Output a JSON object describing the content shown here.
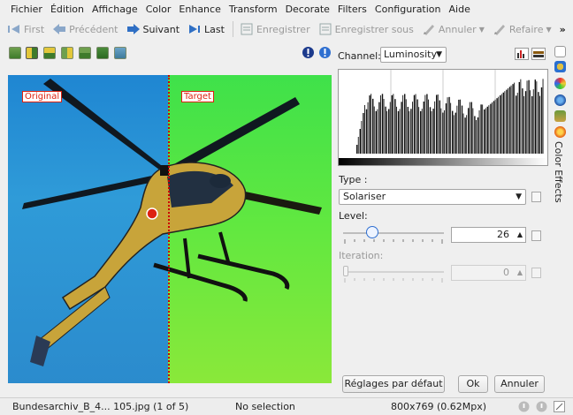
{
  "menubar": {
    "items": [
      "Fichier",
      "Édition",
      "Affichage",
      "Color",
      "Enhance",
      "Transform",
      "Decorate",
      "Filters",
      "Configuration",
      "Aide"
    ]
  },
  "toolbar": {
    "first": "First",
    "previous": "Précédent",
    "next": "Suivant",
    "last": "Last",
    "save": "Enregistrer",
    "save_as": "Enregistrer sous",
    "undo": "Annuler",
    "redo": "Refaire",
    "more": "»"
  },
  "preview": {
    "original_label": "Original",
    "target_label": "Target"
  },
  "channel": {
    "label": "Channel:",
    "value": "Luminosity"
  },
  "settings": {
    "type_label": "Type :",
    "type_value": "Solariser",
    "level_label": "Level:",
    "level_value": "26",
    "level_fraction": 0.26,
    "iteration_label": "Iteration:",
    "iteration_value": "0"
  },
  "buttons": {
    "defaults": "Réglages par défaut",
    "ok": "Ok",
    "cancel": "Annuler"
  },
  "sidebar": {
    "tab_label": "Color Effects"
  },
  "status": {
    "file": "Bundesarchiv_B_4... 105.jpg (1 of 5)",
    "selection": "No selection",
    "size": "800x769 (0.62Mpx)"
  },
  "colors": {
    "accent_blue": "#3a7bd5",
    "label_red": "#dd2211",
    "divider_red": "#cc0000"
  }
}
